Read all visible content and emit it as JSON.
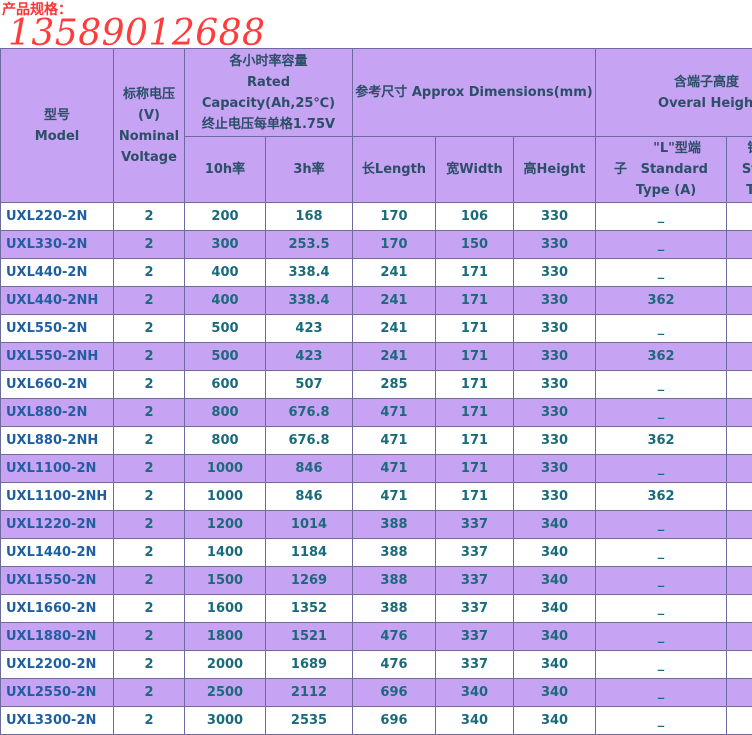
{
  "heading": "产品规格：",
  "phone": "13589012688",
  "table": {
    "model_header": [
      "型号",
      "Model"
    ],
    "voltage_header": [
      "标称电压",
      "(V)",
      "Nominal",
      "Voltage"
    ],
    "capacity_header": [
      "各小时率容量",
      "Rated",
      "Capacity(Ah,25℃)",
      "终止电压每单格1.75V"
    ],
    "capacity_sub": [
      "10h率",
      "3h率"
    ],
    "dims_header": "参考尺寸 Approx Dimensions(mm)",
    "dims_sub": [
      "长Length",
      "宽Width",
      "高Height"
    ],
    "overall_header": [
      "含端子高度",
      "Overal Height"
    ],
    "l_term": [
      "\"L\"型端",
      "子   Standard",
      "Type (A)"
    ],
    "cu_term": [
      "铜",
      "Sta",
      "Ty"
    ],
    "rows": [
      {
        "model": "UXL220-2N",
        "v": "2",
        "c10": "200",
        "c3": "168",
        "l": "170",
        "w": "106",
        "h": "330",
        "oh": "_"
      },
      {
        "model": "UXL330-2N",
        "v": "2",
        "c10": "300",
        "c3": "253.5",
        "l": "170",
        "w": "150",
        "h": "330",
        "oh": "_"
      },
      {
        "model": "UXL440-2N",
        "v": "2",
        "c10": "400",
        "c3": "338.4",
        "l": "241",
        "w": "171",
        "h": "330",
        "oh": "_"
      },
      {
        "model": "UXL440-2NH",
        "v": "2",
        "c10": "400",
        "c3": "338.4",
        "l": "241",
        "w": "171",
        "h": "330",
        "oh": "362"
      },
      {
        "model": "UXL550-2N",
        "v": "2",
        "c10": "500",
        "c3": "423",
        "l": "241",
        "w": "171",
        "h": "330",
        "oh": "_"
      },
      {
        "model": "UXL550-2NH",
        "v": "2",
        "c10": "500",
        "c3": "423",
        "l": "241",
        "w": "171",
        "h": "330",
        "oh": "362"
      },
      {
        "model": "UXL660-2N",
        "v": "2",
        "c10": "600",
        "c3": "507",
        "l": "285",
        "w": "171",
        "h": "330",
        "oh": "_"
      },
      {
        "model": "UXL880-2N",
        "v": "2",
        "c10": "800",
        "c3": "676.8",
        "l": "471",
        "w": "171",
        "h": "330",
        "oh": "_"
      },
      {
        "model": "UXL880-2NH",
        "v": "2",
        "c10": "800",
        "c3": "676.8",
        "l": "471",
        "w": "171",
        "h": "330",
        "oh": "362"
      },
      {
        "model": "UXL1100-2N",
        "v": "2",
        "c10": "1000",
        "c3": "846",
        "l": "471",
        "w": "171",
        "h": "330",
        "oh": "_"
      },
      {
        "model": "UXL1100-2NH",
        "v": "2",
        "c10": "1000",
        "c3": "846",
        "l": "471",
        "w": "171",
        "h": "330",
        "oh": "362"
      },
      {
        "model": "UXL1220-2N",
        "v": "2",
        "c10": "1200",
        "c3": "1014",
        "l": "388",
        "w": "337",
        "h": "340",
        "oh": "_"
      },
      {
        "model": "UXL1440-2N",
        "v": "2",
        "c10": "1400",
        "c3": "1184",
        "l": "388",
        "w": "337",
        "h": "340",
        "oh": "_"
      },
      {
        "model": "UXL1550-2N",
        "v": "2",
        "c10": "1500",
        "c3": "1269",
        "l": "388",
        "w": "337",
        "h": "340",
        "oh": "_"
      },
      {
        "model": "UXL1660-2N",
        "v": "2",
        "c10": "1600",
        "c3": "1352",
        "l": "388",
        "w": "337",
        "h": "340",
        "oh": "_"
      },
      {
        "model": "UXL1880-2N",
        "v": "2",
        "c10": "1800",
        "c3": "1521",
        "l": "476",
        "w": "337",
        "h": "340",
        "oh": "_"
      },
      {
        "model": "UXL2200-2N",
        "v": "2",
        "c10": "2000",
        "c3": "1689",
        "l": "476",
        "w": "337",
        "h": "340",
        "oh": "_"
      },
      {
        "model": "UXL2550-2N",
        "v": "2",
        "c10": "2500",
        "c3": "2112",
        "l": "696",
        "w": "340",
        "h": "340",
        "oh": "_"
      },
      {
        "model": "UXL3300-2N",
        "v": "2",
        "c10": "3000",
        "c3": "2535",
        "l": "696",
        "w": "340",
        "h": "340",
        "oh": "_"
      }
    ]
  }
}
